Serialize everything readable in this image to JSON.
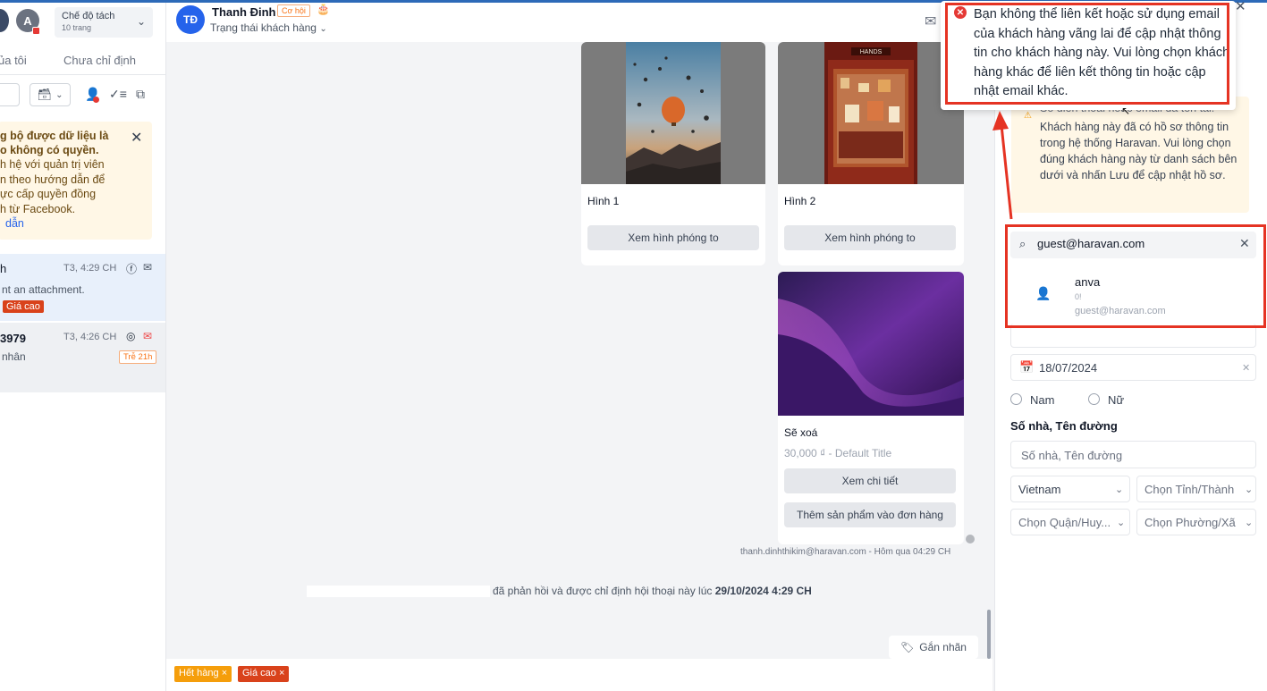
{
  "left_panel": {
    "avatar_letter": "A",
    "mode_title": "Chế độ tách",
    "mode_sub": "10 trang",
    "tab_mine": "ủa tôi",
    "tab_unassigned": "Chưa chỉ định",
    "warning": {
      "bold1": "g bộ được dữ liệu là",
      "bold2": "o không có quyền.",
      "line1": "h hệ với quản trị viên",
      "line2": "n theo hướng dẫn để",
      "line3": "ực cấp quyền đồng",
      "line4": "h từ Facebook.",
      "link": "dẫn"
    },
    "conversations": [
      {
        "name": "h",
        "time": "T3, 4:29 CH",
        "message": "nt an attachment.",
        "tag": "Giá cao"
      },
      {
        "name": "3979",
        "time": "T3, 4:26 CH",
        "message": "nhân",
        "late": "Trễ 21h"
      }
    ]
  },
  "chat_header": {
    "initials": "TĐ",
    "name": "Thanh Đinh",
    "badge": "Cơ hội",
    "status": "Trạng thái khách hàng"
  },
  "cards": [
    {
      "title": "Hình 1",
      "button": "Xem hình phóng to"
    },
    {
      "title": "Hình 2",
      "button": "Xem hình phóng to",
      "shop_sign": "HANDS"
    },
    {
      "title": "Sẽ xoá",
      "subtitle": "30,000 ₫ - Default Title",
      "button1": "Xem chi tiết",
      "button2": "Thêm sản phẩm vào đơn hàng"
    }
  ],
  "chat": {
    "sender": "thanh.dinhthikim@haravan.com - Hôm qua 04:29 CH",
    "assign_text": "đã phản hồi và được chỉ định hội thoại này lúc",
    "assign_time": "29/10/2024 4:29 CH",
    "tag_button": "Gắn nhãn"
  },
  "bottom_tags": [
    {
      "label": "Hết hàng ×",
      "color": "#f59e0b"
    },
    {
      "label": "Giá cao ×",
      "color": "#d9421b"
    }
  ],
  "right_panel": {
    "warning": "Khách hàng này đã có hồ sơ thông tin trong hệ thống Haravan. Vui lòng chọn đúng khách hàng này từ danh sách bên dưới và nhấn Lưu để cập nhật hồ sơ.",
    "warning_top": "Số điện thoại hoặc email đã tồn tại.",
    "search_value": "guest@haravan.com",
    "result": {
      "name": "anva",
      "phone": "0!",
      "email": "guest@haravan.com"
    },
    "birthday": "18/07/2024",
    "gender_male": "Nam",
    "gender_female": "Nữ",
    "address_label": "Số nhà, Tên đường",
    "address_placeholder": "Số nhà, Tên đường",
    "country": "Vietnam",
    "province_placeholder": "Chọn Tỉnh/Thành",
    "district_placeholder": "Chọn Quận/Huy...",
    "ward_placeholder": "Chọn Phường/Xã"
  },
  "toast": {
    "message": "Bạn không thể liên kết hoặc sử dụng email của khách hàng vãng lai để cập nhật thông tin cho khách hàng này. Vui lòng chọn khách hàng khác để liên kết thông tin hoặc cập nhật email khác."
  }
}
